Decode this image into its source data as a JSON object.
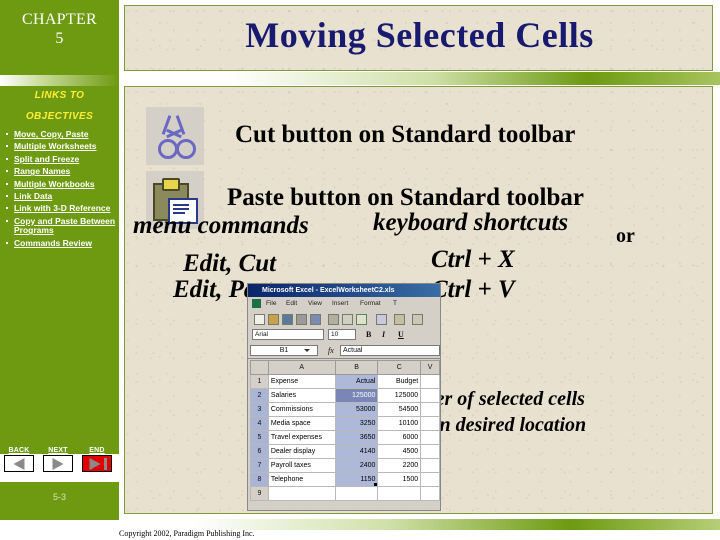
{
  "sidebar": {
    "chapter_label": "CHAPTER",
    "chapter_number": "5",
    "links_to": "LINKS TO",
    "objectives": "OBJECTIVES",
    "objective_links": [
      "Move, Copy, Paste",
      "Multiple Worksheets",
      "Split and Freeze",
      "Range Names",
      "Multiple Workbooks",
      "Link Data",
      "Link with 3-D Reference",
      "Copy and Paste Between Programs",
      "Commands Review"
    ],
    "nav": {
      "back_label": "BACK",
      "next_label": "NEXT",
      "end_label": "END"
    },
    "page_number": "5-3",
    "colors": {
      "green": "#6d9a10",
      "yellow_heading": "#ffee33",
      "end_button_red": "#e00000"
    }
  },
  "header": {
    "title": "Moving Selected Cells",
    "title_color": "#171a6e",
    "panel_background": "#e8e1d0",
    "panel_border": "#7f9b3a"
  },
  "main": {
    "cut_button_caption": "Cut button on Standard toolbar",
    "paste_button_caption": "Paste button on Standard toolbar",
    "menu_commands_heading": "menu commands",
    "keyboard_shortcuts_heading": "keyboard shortcuts",
    "or_word": "or",
    "edit_cut": "Edit, Cut",
    "edit_paste": "Edit, Paste",
    "ctrl_x": "Ctrl + X",
    "ctrl_v": "Ctrl + V",
    "drag_line_1": "drag border of selected cells",
    "drag_line_2": "and drop in desired location",
    "icons": {
      "cut": "scissors-icon",
      "paste": "clipboard-icon"
    }
  },
  "excel": {
    "title_bar": "Microsoft Excel - ExcelWorksheetC2.xls",
    "menu_items": [
      "File",
      "Edit",
      "View",
      "Insert",
      "Format",
      "T"
    ],
    "font_name": "Arial",
    "font_size": "10",
    "format_buttons": [
      "B",
      "I",
      "U"
    ],
    "name_box": "B1",
    "fx_label": "fx",
    "formula_value": "Actual",
    "column_headers": [
      "A",
      "B",
      "C",
      "V"
    ],
    "selected_column": "B",
    "row_numbers": [
      "1",
      "2",
      "3",
      "4",
      "5",
      "6",
      "7",
      "8",
      "9"
    ],
    "rows": [
      {
        "num": "1",
        "a": "Expense",
        "b": "Actual",
        "c": "Budget"
      },
      {
        "num": "2",
        "a": "Salaries",
        "b": "125000",
        "c": "125000"
      },
      {
        "num": "3",
        "a": "Commissions",
        "b": "53000",
        "c": "54500"
      },
      {
        "num": "4",
        "a": "Media space",
        "b": "3250",
        "c": "10100"
      },
      {
        "num": "5",
        "a": "Travel expenses",
        "b": "3650",
        "c": "6000"
      },
      {
        "num": "6",
        "a": "Dealer display",
        "b": "4140",
        "c": "4500"
      },
      {
        "num": "7",
        "a": "Payroll taxes",
        "b": "2400",
        "c": "2200"
      },
      {
        "num": "8",
        "a": "Telephone",
        "b": "1150",
        "c": "1500"
      },
      {
        "num": "9",
        "a": "",
        "b": "",
        "c": ""
      }
    ]
  },
  "footer": {
    "copyright": "Copyright 2002, Paradigm Publishing Inc."
  }
}
